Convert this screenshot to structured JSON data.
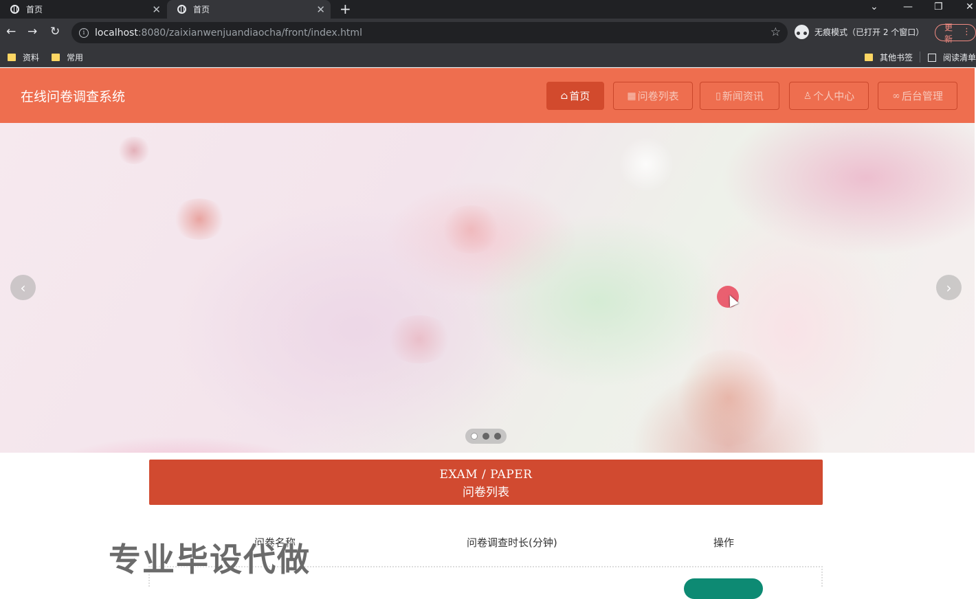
{
  "browser": {
    "tabs": [
      {
        "title": "首页"
      },
      {
        "title": "首页"
      }
    ],
    "url_host": "localhost",
    "url_path": ":8080/zaixianwenjuandiaocha/front/index.html",
    "incognito_label": "无痕模式（已打开 2 个窗口）",
    "update_label": "更新",
    "bookmarks": {
      "left": [
        "资料",
        "常用"
      ],
      "other": "其他书签",
      "reading_list": "阅读清单"
    }
  },
  "site": {
    "title": "在线问卷调查系统",
    "nav": [
      {
        "label": "首页",
        "icon": "home-icon",
        "active": true
      },
      {
        "label": "问卷列表",
        "icon": "grid-icon",
        "active": false
      },
      {
        "label": "新闻资讯",
        "icon": "news-icon",
        "active": false
      },
      {
        "label": "个人中心",
        "icon": "user-icon",
        "active": false
      },
      {
        "label": "后台管理",
        "icon": "link-icon",
        "active": false
      }
    ]
  },
  "carousel": {
    "slide_count": 3,
    "active_index": 0
  },
  "section": {
    "title_en": "EXAM / PAPER",
    "title_zh": "问卷列表"
  },
  "table": {
    "headers": [
      "问卷名称",
      "问卷调查时长(分钟)",
      "操作"
    ]
  },
  "overlay_text": "专业毕设代做",
  "colors": {
    "header_bg": "#ee6e4f",
    "nav_active": "#d24a2d",
    "section_bar": "#d14a30",
    "action_button": "#0d8a73"
  }
}
